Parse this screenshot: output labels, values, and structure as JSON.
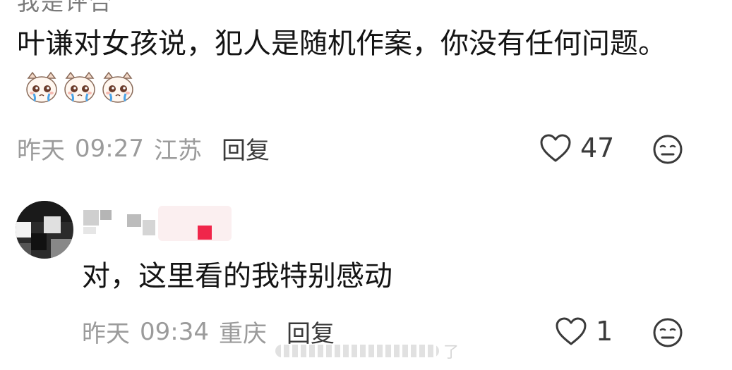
{
  "comment1": {
    "username_cutoff": "我是评合",
    "text": "叶谦对女孩说，犯人是随机作案，你没有任何问题。",
    "emojis": [
      "crying-cat-icon",
      "crying-cat-icon",
      "crying-cat-icon"
    ],
    "time_day": "昨天",
    "time": "09:27",
    "location": "江苏",
    "reply_label": "回复",
    "like_count": "47",
    "react_icon": "neutral-face-icon"
  },
  "comment2": {
    "avatar_icon": "blurred-avatar",
    "username": "",
    "text": "对，这里看的我特别感动",
    "time_day": "昨天",
    "time": "09:34",
    "location": "重庆",
    "reply_label": "回复",
    "like_count": "1",
    "react_icon": "neutral-face-icon"
  },
  "watermark": {
    "text": "了"
  },
  "colors": {
    "text": "#141414",
    "meta": "#9b9b9b",
    "badge_red": "#f0264a"
  }
}
